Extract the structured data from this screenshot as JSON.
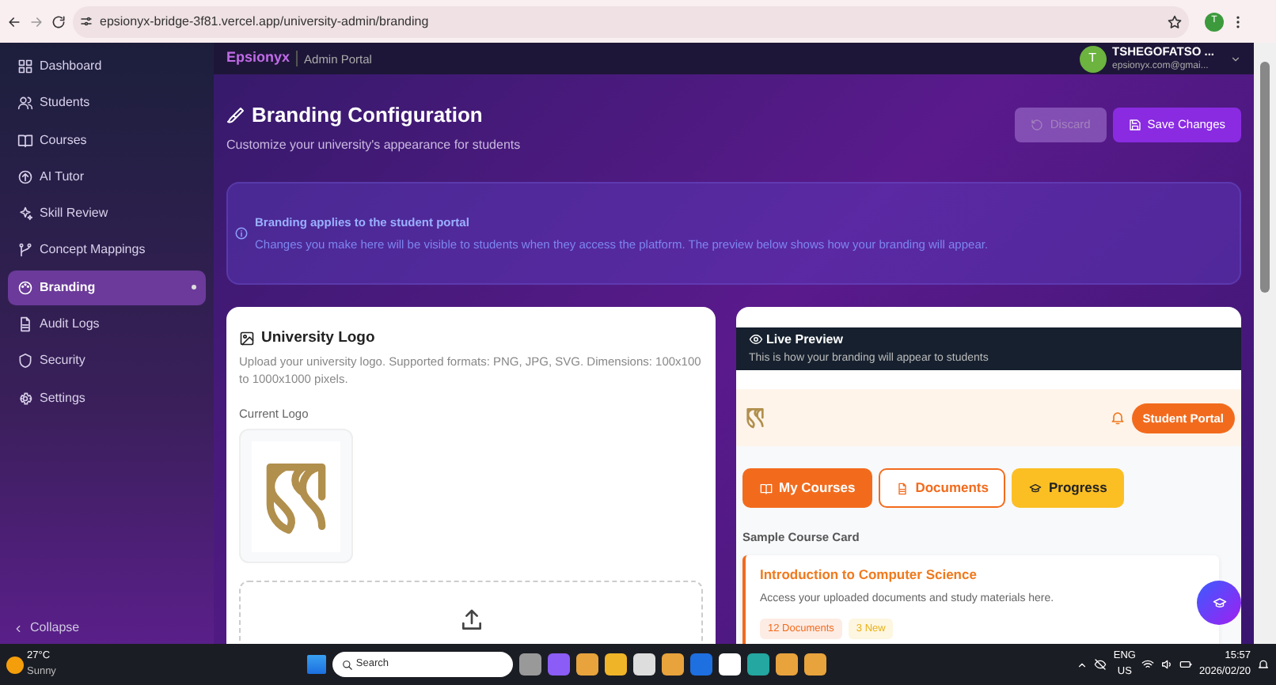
{
  "browser": {
    "url": "epsionyx-bridge-3f81.vercel.app/university-admin/branding",
    "profile_initial": "T"
  },
  "sidebar": {
    "items": [
      {
        "label": "Dashboard",
        "selected": false
      },
      {
        "label": "Students",
        "selected": false
      },
      {
        "label": "Courses",
        "selected": false
      },
      {
        "label": "AI Tutor",
        "selected": false
      },
      {
        "label": "Skill Review",
        "selected": false
      },
      {
        "label": "Concept Mappings",
        "selected": false
      },
      {
        "label": "Branding",
        "selected": true
      },
      {
        "label": "Audit Logs",
        "selected": false
      },
      {
        "label": "Security",
        "selected": false
      },
      {
        "label": "Settings",
        "selected": false
      }
    ],
    "collapse": "Collapse"
  },
  "header": {
    "brand": "Epsionyx",
    "portal": "Admin Portal",
    "user": {
      "initial": "T",
      "name": "TSHEGOFATSO ...",
      "email": "epsionyx.com@gmai..."
    }
  },
  "page": {
    "title": "Branding Configuration",
    "subtitle": "Customize your university's appearance for students",
    "buttons": [
      {
        "label": "Discard",
        "kind": "discard",
        "disabled": true
      },
      {
        "label": "Save Changes",
        "kind": "save",
        "disabled": false
      }
    ]
  },
  "notice": {
    "title": "Branding applies to the student portal",
    "text": "Changes you make here will be visible to students when they access the platform. The preview below shows how your branding will appear."
  },
  "logo_card": {
    "title": "University Logo",
    "description": "Upload your university logo. Supported formats: PNG, JPG, SVG. Dimensions: 100x100 to 1000x1000 pixels.",
    "current_label": "Current Logo"
  },
  "preview": {
    "title": "Live Preview",
    "subtitle": "This is how your branding will appear to students",
    "portal_badge": "Student Portal",
    "tabs": [
      {
        "label": "My Courses",
        "kind": "primary"
      },
      {
        "label": "Documents",
        "kind": "outline"
      },
      {
        "label": "Progress",
        "kind": "accent"
      }
    ],
    "sample_label": "Sample Course Card",
    "course": {
      "title": "Introduction to Computer Science",
      "description": "Access your uploaded documents and study materials here.",
      "tags": [
        {
          "label": "12 Documents",
          "kind": "count"
        },
        {
          "label": "3 New",
          "kind": "new"
        }
      ]
    }
  },
  "taskbar": {
    "weather": {
      "temp": "27°C",
      "condition": "Sunny"
    },
    "search_placeholder": "Search",
    "language": [
      "ENG",
      "US"
    ],
    "time": "15:57",
    "date": "2026/02/20"
  }
}
